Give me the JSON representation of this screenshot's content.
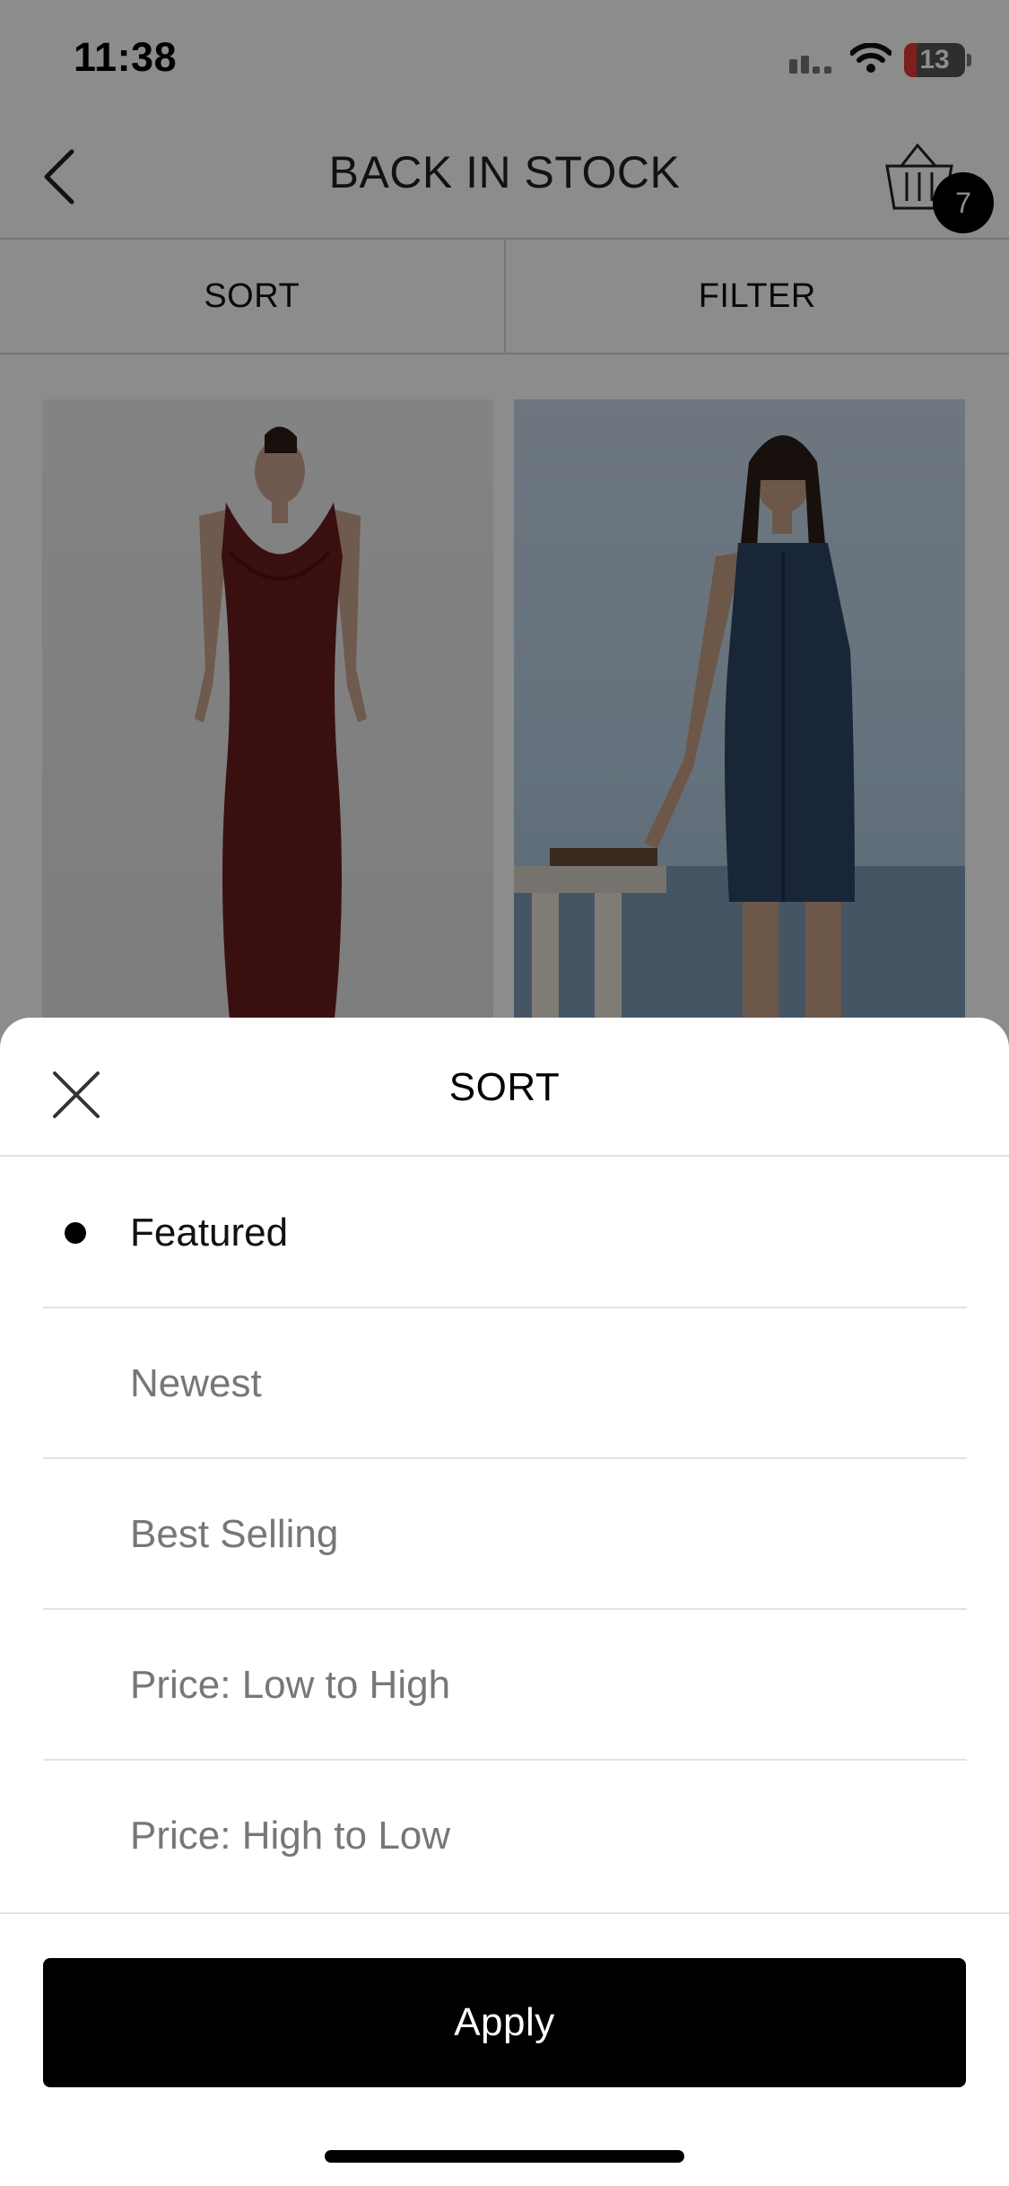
{
  "status_bar": {
    "time": "11:38",
    "battery": "13"
  },
  "header": {
    "title": "BACK IN STOCK",
    "cart_count": "7"
  },
  "tabs": [
    {
      "label": "SORT"
    },
    {
      "label": "FILTER"
    }
  ],
  "sheet": {
    "title": "SORT",
    "options": [
      {
        "label": "Featured",
        "selected": true
      },
      {
        "label": "Newest",
        "selected": false
      },
      {
        "label": "Best Selling",
        "selected": false
      },
      {
        "label": "Price: Low to High",
        "selected": false
      },
      {
        "label": "Price: High to Low",
        "selected": false
      }
    ],
    "apply_label": "Apply"
  },
  "icons": {
    "back": "chevron-left-icon",
    "cart": "basket-icon",
    "close": "close-icon",
    "selected": "dot-icon"
  },
  "colors": {
    "accent": "#000000",
    "overlay": "rgba(0,0,0,0.45)"
  }
}
